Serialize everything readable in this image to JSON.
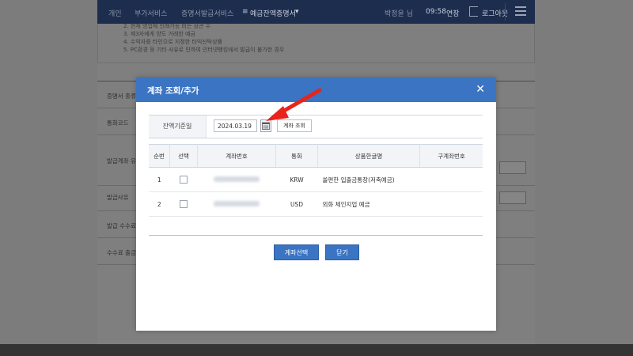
{
  "topnav": {
    "items": [
      "개인",
      "부가서비스",
      "증명서발급서비스",
      "예금잔액증명서"
    ],
    "user": "박정윤 님",
    "time": "09:58",
    "extend": "연장",
    "logout": "로그아웃"
  },
  "notice_lines": [
    "2. 현재 영업에 인래가능 비는 장관 수",
    "3. 제3자에게 양도 거래한 예금",
    "4. 수익자를 타인으로 지정한 타익신탁상품",
    "5. PC환경 등 기타 사유로 인하여 인터넷뱅킹에서 발급이 불가한 경우"
  ],
  "bg_labels": [
    "증명서 종류",
    "통화코드",
    "발급계좌 유",
    "발급사유",
    "발급 수수료",
    "수수료 출금"
  ],
  "modal": {
    "title": "계좌 조회/추가",
    "search": {
      "label": "잔액기준일",
      "date_value": "2024.03.19",
      "query_button": "계좌 조회"
    },
    "table": {
      "headers": [
        "순번",
        "선택",
        "계좌번호",
        "통화",
        "상품한글명",
        "구계좌번호"
      ],
      "rows": [
        {
          "no": "1",
          "currency": "KRW",
          "product": "쏠편한 입출금통장(저축예금)"
        },
        {
          "no": "2",
          "currency": "USD",
          "product": "외화 체인지업 예금"
        }
      ]
    },
    "buttons": {
      "select": "계좌선택",
      "close": "닫기"
    }
  },
  "colors": {
    "modal_header": "#3b74c2",
    "button": "#3b74c2",
    "arrow": "#e8241c"
  }
}
